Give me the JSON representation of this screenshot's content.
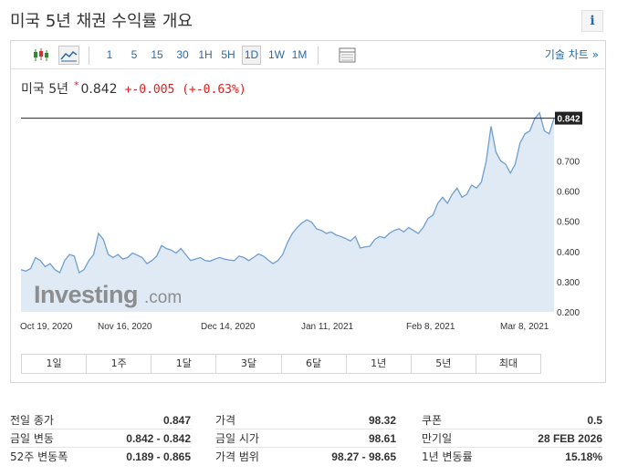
{
  "page": {
    "title": "미국 5년 채권 수익률 개요",
    "info_icon": "i"
  },
  "toolbar": {
    "chart_types": [
      "candlestick-icon",
      "line-chart-icon"
    ],
    "intervals": [
      "1",
      "5",
      "15",
      "30",
      "1H",
      "5H",
      "1D",
      "1W",
      "1M"
    ],
    "active_interval": "1D",
    "table_icon": "table-icon",
    "tech_chart_label": "기술 차트 »"
  },
  "quote": {
    "name": "미국 5년",
    "star": "*",
    "price": "0.842",
    "change": "+-0.005 (+-0.63%)",
    "change_color": "#e02020"
  },
  "watermark": {
    "brand": "Investing",
    "suffix": ".com"
  },
  "chart_data": {
    "type": "area",
    "x_tick_labels": [
      "Oct 19, 2020",
      "Nov 16, 2020",
      "Dec 14, 2020",
      "Jan 11, 2021",
      "Feb 8, 2021",
      "Mar 8, 2021"
    ],
    "y_tick_labels": [
      "0.200",
      "0.300",
      "0.400",
      "0.500",
      "0.600",
      "0.700"
    ],
    "ylim": [
      0.2,
      0.88
    ],
    "values": [
      0.34,
      0.335,
      0.344,
      0.38,
      0.37,
      0.35,
      0.36,
      0.34,
      0.33,
      0.37,
      0.39,
      0.385,
      0.33,
      0.34,
      0.37,
      0.39,
      0.46,
      0.44,
      0.39,
      0.38,
      0.39,
      0.375,
      0.38,
      0.395,
      0.388,
      0.38,
      0.36,
      0.37,
      0.385,
      0.42,
      0.41,
      0.405,
      0.395,
      0.41,
      0.39,
      0.37,
      0.375,
      0.38,
      0.37,
      0.368,
      0.375,
      0.38,
      0.375,
      0.372,
      0.37,
      0.385,
      0.38,
      0.37,
      0.38,
      0.392,
      0.385,
      0.372,
      0.36,
      0.37,
      0.39,
      0.43,
      0.46,
      0.48,
      0.495,
      0.505,
      0.497,
      0.475,
      0.47,
      0.46,
      0.465,
      0.455,
      0.45,
      0.443,
      0.435,
      0.45,
      0.412,
      0.415,
      0.418,
      0.44,
      0.45,
      0.445,
      0.46,
      0.47,
      0.475,
      0.465,
      0.48,
      0.47,
      0.46,
      0.48,
      0.51,
      0.52,
      0.56,
      0.58,
      0.56,
      0.59,
      0.61,
      0.58,
      0.59,
      0.62,
      0.61,
      0.63,
      0.7,
      0.815,
      0.73,
      0.7,
      0.69,
      0.66,
      0.69,
      0.76,
      0.79,
      0.8,
      0.84,
      0.86,
      0.8,
      0.79,
      0.842
    ],
    "last_value_label": "0.842",
    "line_color": "#6f9fcf",
    "fill_color": "#dfeaf4",
    "grid": false
  },
  "range_buttons": [
    "1일",
    "1주",
    "1달",
    "3달",
    "6달",
    "1년",
    "5년",
    "최대"
  ],
  "stats": {
    "col1": [
      {
        "label": "전일 종가",
        "value": "0.847"
      },
      {
        "label": "금일 변동",
        "value": "0.842 - 0.842"
      },
      {
        "label": "52주 변동폭",
        "value": "0.189 - 0.865"
      }
    ],
    "col2": [
      {
        "label": "가격",
        "value": "98.32"
      },
      {
        "label": "금일 시가",
        "value": "98.61"
      },
      {
        "label": "가격 범위",
        "value": "98.27 - 98.65"
      }
    ],
    "col3": [
      {
        "label": "쿠폰",
        "value": "0.5"
      },
      {
        "label": "만기일",
        "value": "28 FEB 2026"
      },
      {
        "label": "1년 변동률",
        "value": "15.18%"
      }
    ]
  }
}
